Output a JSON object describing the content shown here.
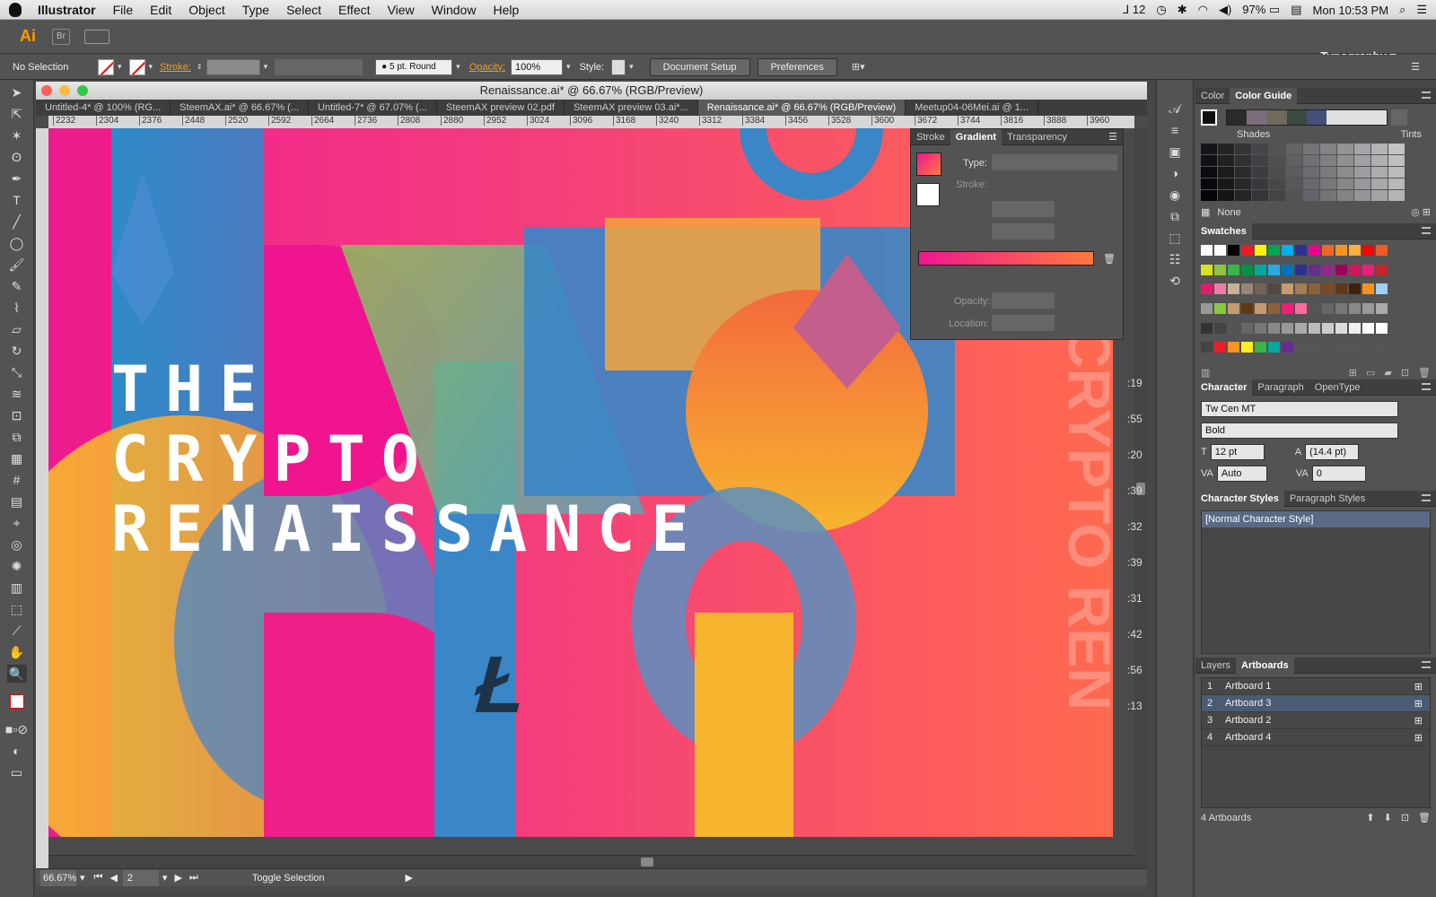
{
  "menubar": {
    "app": "Illustrator",
    "items": [
      "File",
      "Edit",
      "Object",
      "Type",
      "Select",
      "Effect",
      "View",
      "Window",
      "Help"
    ],
    "status": {
      "notify": "12",
      "battery": "97%",
      "clock": "Mon 10:53 PM"
    }
  },
  "appbar": {
    "logo": "Ai",
    "bridge": "Br",
    "workspace": "Typography"
  },
  "control": {
    "selection": "No Selection",
    "stroke_label": "Stroke:",
    "brush": "5 pt. Round",
    "opacity_label": "Opacity:",
    "opacity_value": "100%",
    "style_label": "Style:",
    "doc_setup": "Document Setup",
    "preferences": "Preferences"
  },
  "document": {
    "title": "Renaissance.ai* @ 66.67% (RGB/Preview)",
    "tabs": [
      "Untitled-4* @ 100% (RG...",
      "SteemAX.ai* @ 66.67% (...",
      "Untitled-7* @ 67.07% (...",
      "SteemAX preview 02.pdf",
      "SteemAX preview 03.ai*...",
      "Renaissance.ai* @ 66.67% (RGB/Preview)",
      "Meetup04-06Mei.ai @ 1..."
    ],
    "ruler_ticks": [
      "2232",
      "2304",
      "2376",
      "2448",
      "2520",
      "2592",
      "2664",
      "2736",
      "2808",
      "2880",
      "2952",
      "3024",
      "3096",
      "3168",
      "3240",
      "3312",
      "3384",
      "3456",
      "3528",
      "3600",
      "3672",
      "3744",
      "3816",
      "3888",
      "3960"
    ],
    "artwork": {
      "line1": "THE",
      "line2": "CRYPTO",
      "line3": "RENAISSANCE"
    },
    "status": {
      "zoom": "66.67%",
      "artboard": "2",
      "action": "Toggle Selection"
    }
  },
  "gradient_panel": {
    "tabs": [
      "Stroke",
      "Gradient",
      "Transparency"
    ],
    "type_label": "Type:",
    "stroke_label": "Stroke:",
    "opacity_label": "Opacity:",
    "location_label": "Location:",
    "colors": {
      "start": "#f0168f",
      "end": "#ff7a3e"
    }
  },
  "time_list": [
    ":19",
    ":55",
    ":20",
    ":39",
    ":32",
    ":39",
    ":31",
    ":42",
    ":56",
    ":13"
  ],
  "color_panel": {
    "tabs": [
      "Color",
      "Color Guide"
    ],
    "shades_label": "Shades",
    "tints_label": "Tints",
    "none_label": "None"
  },
  "swatches_panel": {
    "title": "Swatches"
  },
  "character_panel": {
    "tabs": [
      "Character",
      "Paragraph",
      "OpenType"
    ],
    "font": "Tw Cen MT",
    "style": "Bold",
    "size": "12 pt",
    "leading": "(14.4 pt)",
    "kerning": "Auto",
    "tracking": "0"
  },
  "char_styles_panel": {
    "tabs": [
      "Character Styles",
      "Paragraph Styles"
    ],
    "item": "[Normal Character Style]"
  },
  "artboards_panel": {
    "tabs": [
      "Layers",
      "Artboards"
    ],
    "items": [
      {
        "num": "1",
        "name": "Artboard 1"
      },
      {
        "num": "2",
        "name": "Artboard 3"
      },
      {
        "num": "3",
        "name": "Artboard 2"
      },
      {
        "num": "4",
        "name": "Artboard 4"
      }
    ],
    "count": "4 Artboards"
  }
}
